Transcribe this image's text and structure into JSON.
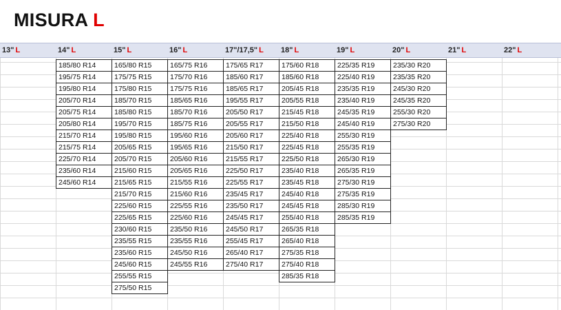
{
  "title": {
    "text": "MISURA ",
    "accent": "L"
  },
  "header_suffix": "L",
  "columns": [
    {
      "label": "13\"",
      "sizes": []
    },
    {
      "label": "14\"",
      "sizes": [
        "185/80 R14",
        "195/75 R14",
        "195/80 R14",
        "205/70 R14",
        "205/75 R14",
        "205/80 R14",
        "215/70 R14",
        "215/75 R14",
        "225/70 R14",
        "235/60 R14",
        "245/60 R14"
      ]
    },
    {
      "label": "15\"",
      "sizes": [
        "165/80 R15",
        "175/75 R15",
        "175/80 R15",
        "185/70 R15",
        "185/80 R15",
        "195/70 R15",
        "195/80 R15",
        "205/65 R15",
        "205/70 R15",
        "215/60 R15",
        "215/65 R15",
        "215/70 R15",
        "225/60 R15",
        "225/65 R15",
        "230/60 R15",
        "235/55 R15",
        "235/60 R15",
        "245/60 R15",
        "255/55 R15",
        "275/50 R15"
      ]
    },
    {
      "label": "16\"",
      "sizes": [
        "165/75 R16",
        "175/70 R16",
        "175/75 R16",
        "185/65 R16",
        "185/70 R16",
        "185/75 R16",
        "195/60 R16",
        "195/65 R16",
        "205/60 R16",
        "205/65 R16",
        "215/55 R16",
        "215/60 R16",
        "225/55 R16",
        "225/60 R16",
        "235/50 R16",
        "235/55 R16",
        "245/50 R16",
        "245/55 R16"
      ]
    },
    {
      "label": "17\"/17,5\"",
      "sizes": [
        "175/65 R17",
        "185/60 R17",
        "185/65 R17",
        "195/55 R17",
        "205/50 R17",
        "205/55 R17",
        "205/60 R17",
        "215/50 R17",
        "215/55 R17",
        "225/50 R17",
        "225/55 R17",
        "235/45 R17",
        "235/50 R17",
        "245/45 R17",
        "245/50 R17",
        "255/45 R17",
        "265/40 R17",
        "275/40 R17"
      ]
    },
    {
      "label": "18\"",
      "sizes": [
        "175/60 R18",
        "185/60 R18",
        "205/45 R18",
        "205/55 R18",
        "215/45 R18",
        "215/50 R18",
        "225/40 R18",
        "225/45 R18",
        "225/50 R18",
        "235/40 R18",
        "235/45 R18",
        "245/40 R18",
        "245/45 R18",
        "255/40 R18",
        "265/35 R18",
        "265/40 R18",
        "275/35 R18",
        "275/40 R18",
        "285/35 R18"
      ]
    },
    {
      "label": "19\"",
      "sizes": [
        "225/35 R19",
        "225/40 R19",
        "235/35 R19",
        "235/40 R19",
        "245/35 R19",
        "245/40 R19",
        "255/30 R19",
        "255/35 R19",
        "265/30 R19",
        "265/35 R19",
        "275/30 R19",
        "275/35 R19",
        "285/30 R19",
        "285/35 R19"
      ]
    },
    {
      "label": "20\"",
      "sizes": [
        "235/30 R20",
        "235/35 R20",
        "245/30 R20",
        "245/35 R20",
        "255/30 R20",
        "275/30 R20"
      ]
    },
    {
      "label": "21\"",
      "sizes": []
    },
    {
      "label": "22\"",
      "sizes": []
    }
  ]
}
